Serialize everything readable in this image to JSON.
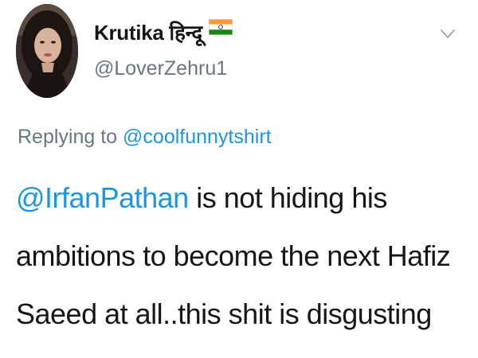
{
  "tweet": {
    "author": {
      "display_name": "Krutika हिन्दू",
      "flag_icon": "india-flag-icon",
      "handle": "@LoverZehru1",
      "avatar": "profile-photo"
    },
    "menu_icon": "chevron-down-icon",
    "replying_to": {
      "prefix": "Replying to",
      "mention": "@coolfunnytshirt"
    },
    "body": {
      "mention": "@IrfanPathan",
      "line1_rest": "is not hiding his",
      "line2": "ambitions to become the next Hafiz",
      "line3": "Saeed at all..this shit is disgusting"
    },
    "colors": {
      "link": "#1b95e0",
      "secondary_text": "#657786",
      "primary_text": "#14171a"
    }
  }
}
